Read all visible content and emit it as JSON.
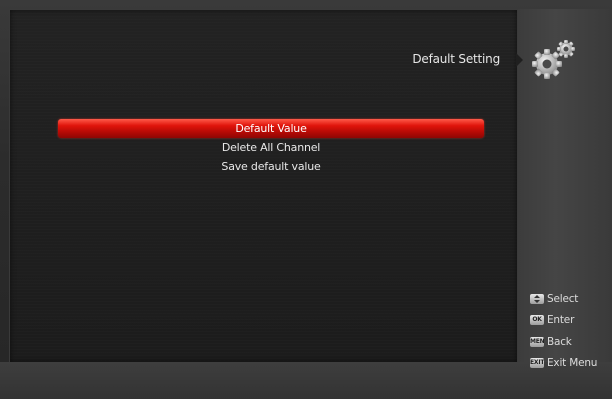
{
  "header": {
    "title": "Default Setting",
    "icon": "gears-icon"
  },
  "menu": {
    "items": [
      {
        "label": "Default Value",
        "selected": true
      },
      {
        "label": "Delete All Channel",
        "selected": false
      },
      {
        "label": "Save default value",
        "selected": false
      }
    ]
  },
  "legend": {
    "items": [
      {
        "key": "up-down-key-icon",
        "label": "Select"
      },
      {
        "key": "ok-key-icon",
        "label": "Enter"
      },
      {
        "key": "menu-key-icon",
        "label": "Back"
      },
      {
        "key": "exit-key-icon",
        "label": "Exit Menu"
      }
    ]
  },
  "colors": {
    "highlight": "#e0140b",
    "panel": "#1f1f1f",
    "sidebar": "#424242"
  }
}
